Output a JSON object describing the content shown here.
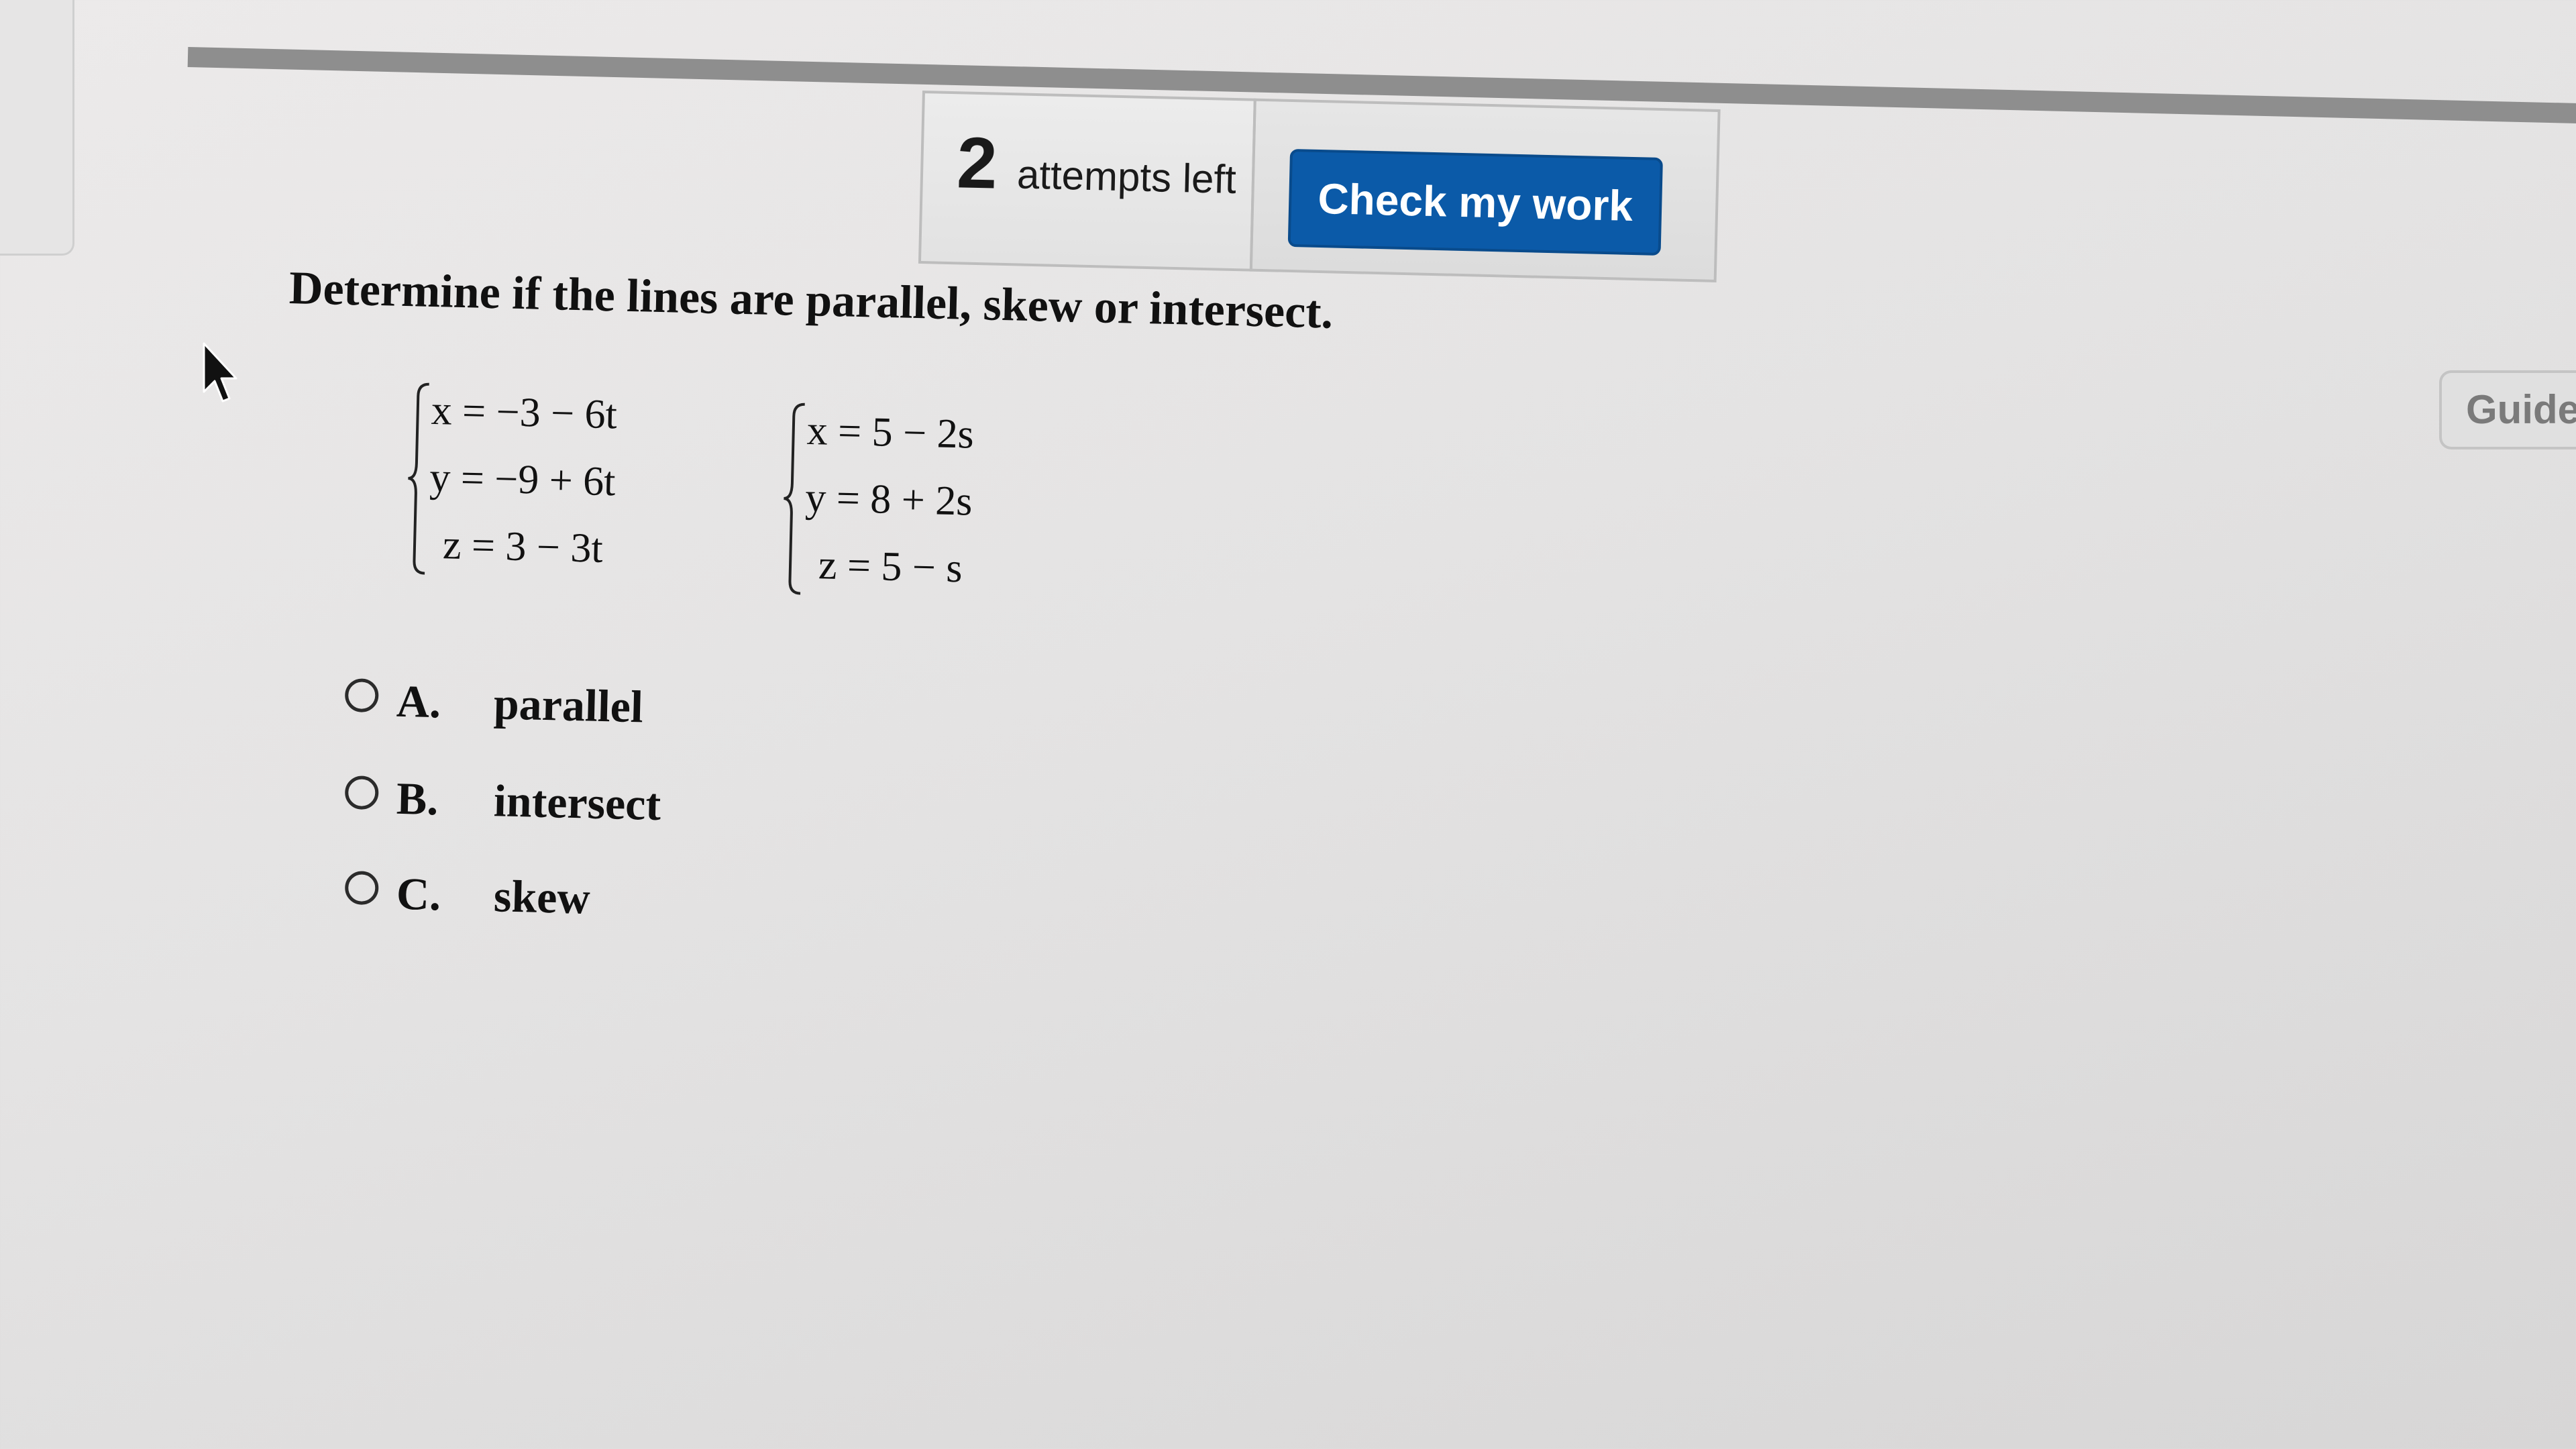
{
  "toolbar": {
    "attempts_count": "2",
    "attempts_label": "attempts left",
    "check_button_label": "Check my work"
  },
  "question": {
    "prompt": "Determine if the lines are parallel, skew or intersect.",
    "line_1": {
      "x_eq": "x = −3 − 6t",
      "y_eq": "y = −9 + 6t",
      "z_eq": "z = 3 − 3t"
    },
    "line_2": {
      "x_eq": "x = 5 − 2s",
      "y_eq": "y = 8 + 2s",
      "z_eq": "z = 5 − s"
    }
  },
  "options": [
    {
      "letter": "A.",
      "text": "parallel",
      "selected": false
    },
    {
      "letter": "B.",
      "text": "intersect",
      "selected": false
    },
    {
      "letter": "C.",
      "text": "skew",
      "selected": false
    }
  ],
  "side_tab": {
    "label": "Guided"
  },
  "colors": {
    "primary_button": "#0b5aa8",
    "background": "#e4e3e3"
  },
  "icons": {
    "cursor": "pointer-arrow-icon"
  }
}
